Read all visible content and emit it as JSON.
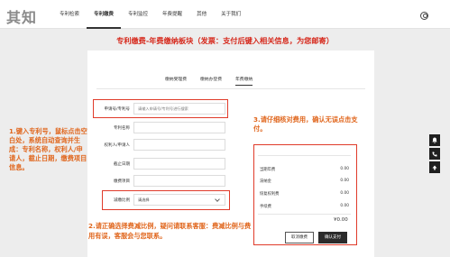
{
  "logo": "其知",
  "nav": [
    {
      "label": "专利检索"
    },
    {
      "label": "专利缴费"
    },
    {
      "label": "专利监控"
    },
    {
      "label": "年费提醒"
    },
    {
      "label": "其他"
    },
    {
      "label": "关于我们"
    }
  ],
  "headline": "专利缴费-年费缴纳板块（发票：支付后键入相关信息，为您邮寄）",
  "subtabs": [
    {
      "label": "缴纳受理费"
    },
    {
      "label": "缴纳办登费"
    },
    {
      "label": "年费缴纳"
    }
  ],
  "form": {
    "fields": [
      {
        "label": "申请号/专利号",
        "placeholder": "请输入申请号/专利号进行搜索"
      },
      {
        "label": "专利名称",
        "placeholder": ""
      },
      {
        "label": "权利人/申请人",
        "placeholder": ""
      },
      {
        "label": "截止日期",
        "placeholder": ""
      },
      {
        "label": "缴费项目",
        "placeholder": ""
      }
    ],
    "ratio_label": "减缴比例",
    "ratio_value": "请选择"
  },
  "notes": {
    "n1": "1.键入专利号，鼠标点击空白处，系统自动查询并生成：专利名称，权利人/申请人，截止日期，缴费项目信息。",
    "n2": "2.请正确选择费减比例，疑问请联系客服：费减比例与费用有误，客服会与您联系。",
    "n3": "3.请仔细核对费用，确认无误点击支付。"
  },
  "fees": [
    {
      "name": "当期年费",
      "amount": "0.00"
    },
    {
      "name": "滞纳金",
      "amount": "0.00"
    },
    {
      "name": "恢复权利费",
      "amount": "0.00"
    },
    {
      "name": "手续费",
      "amount": "0.00"
    }
  ],
  "total": "¥0.00",
  "buttons": {
    "cancel": "取消缴费",
    "pay": "确认支付"
  },
  "side_icons": [
    "bell-icon",
    "phone-icon",
    "back-to-top-icon"
  ],
  "colors": {
    "accent_red": "#d6281b",
    "note_orange": "#e0661d",
    "highlight_border": "#e03b2a"
  }
}
